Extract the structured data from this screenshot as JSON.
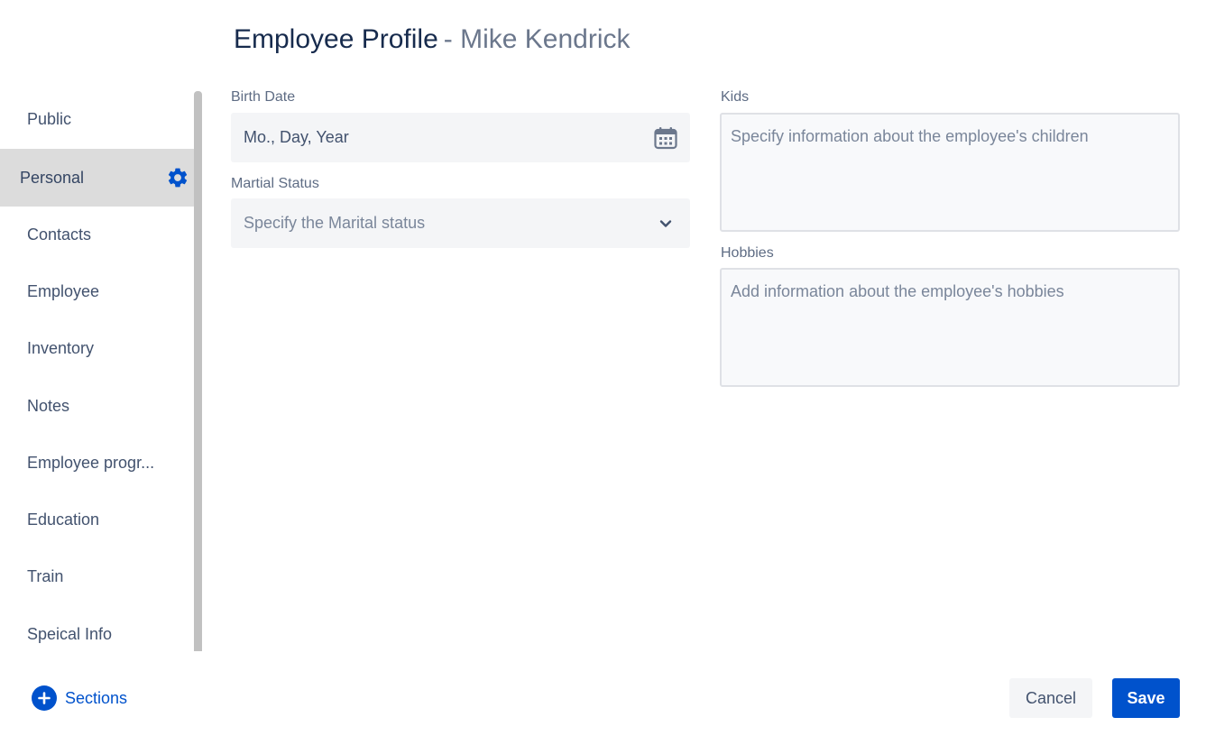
{
  "header": {
    "title": "Employee Profile",
    "subtitle": "- Mike Kendrick"
  },
  "sidebar": {
    "items": [
      {
        "label": "Public"
      },
      {
        "label": "Personal"
      },
      {
        "label": "Contacts"
      },
      {
        "label": "Employee"
      },
      {
        "label": "Inventory"
      },
      {
        "label": "Notes"
      },
      {
        "label": "Employee progr..."
      },
      {
        "label": "Education"
      },
      {
        "label": "Train"
      },
      {
        "label": "Speical Info"
      }
    ],
    "active_icon": "gear-icon"
  },
  "form": {
    "birth_date": {
      "label": "Birth Date",
      "placeholder": "Mo., Day, Year",
      "icon": "calendar-icon"
    },
    "marital_status": {
      "label": "Martial Status",
      "placeholder": "Specify the Marital status",
      "icon": "chevron-down-icon"
    },
    "kids": {
      "label": "Kids",
      "placeholder": "Specify information about the employee's children"
    },
    "hobbies": {
      "label": "Hobbies",
      "placeholder": "Add information about the employee's hobbies"
    }
  },
  "footer": {
    "add_sections_label": "Sections",
    "add_sections_icon": "plus-circle-icon",
    "cancel_label": "Cancel",
    "save_label": "Save"
  },
  "colors": {
    "accent": "#0052cc",
    "active_bg": "#dcdcdc",
    "field_bg": "#f4f5f7"
  }
}
